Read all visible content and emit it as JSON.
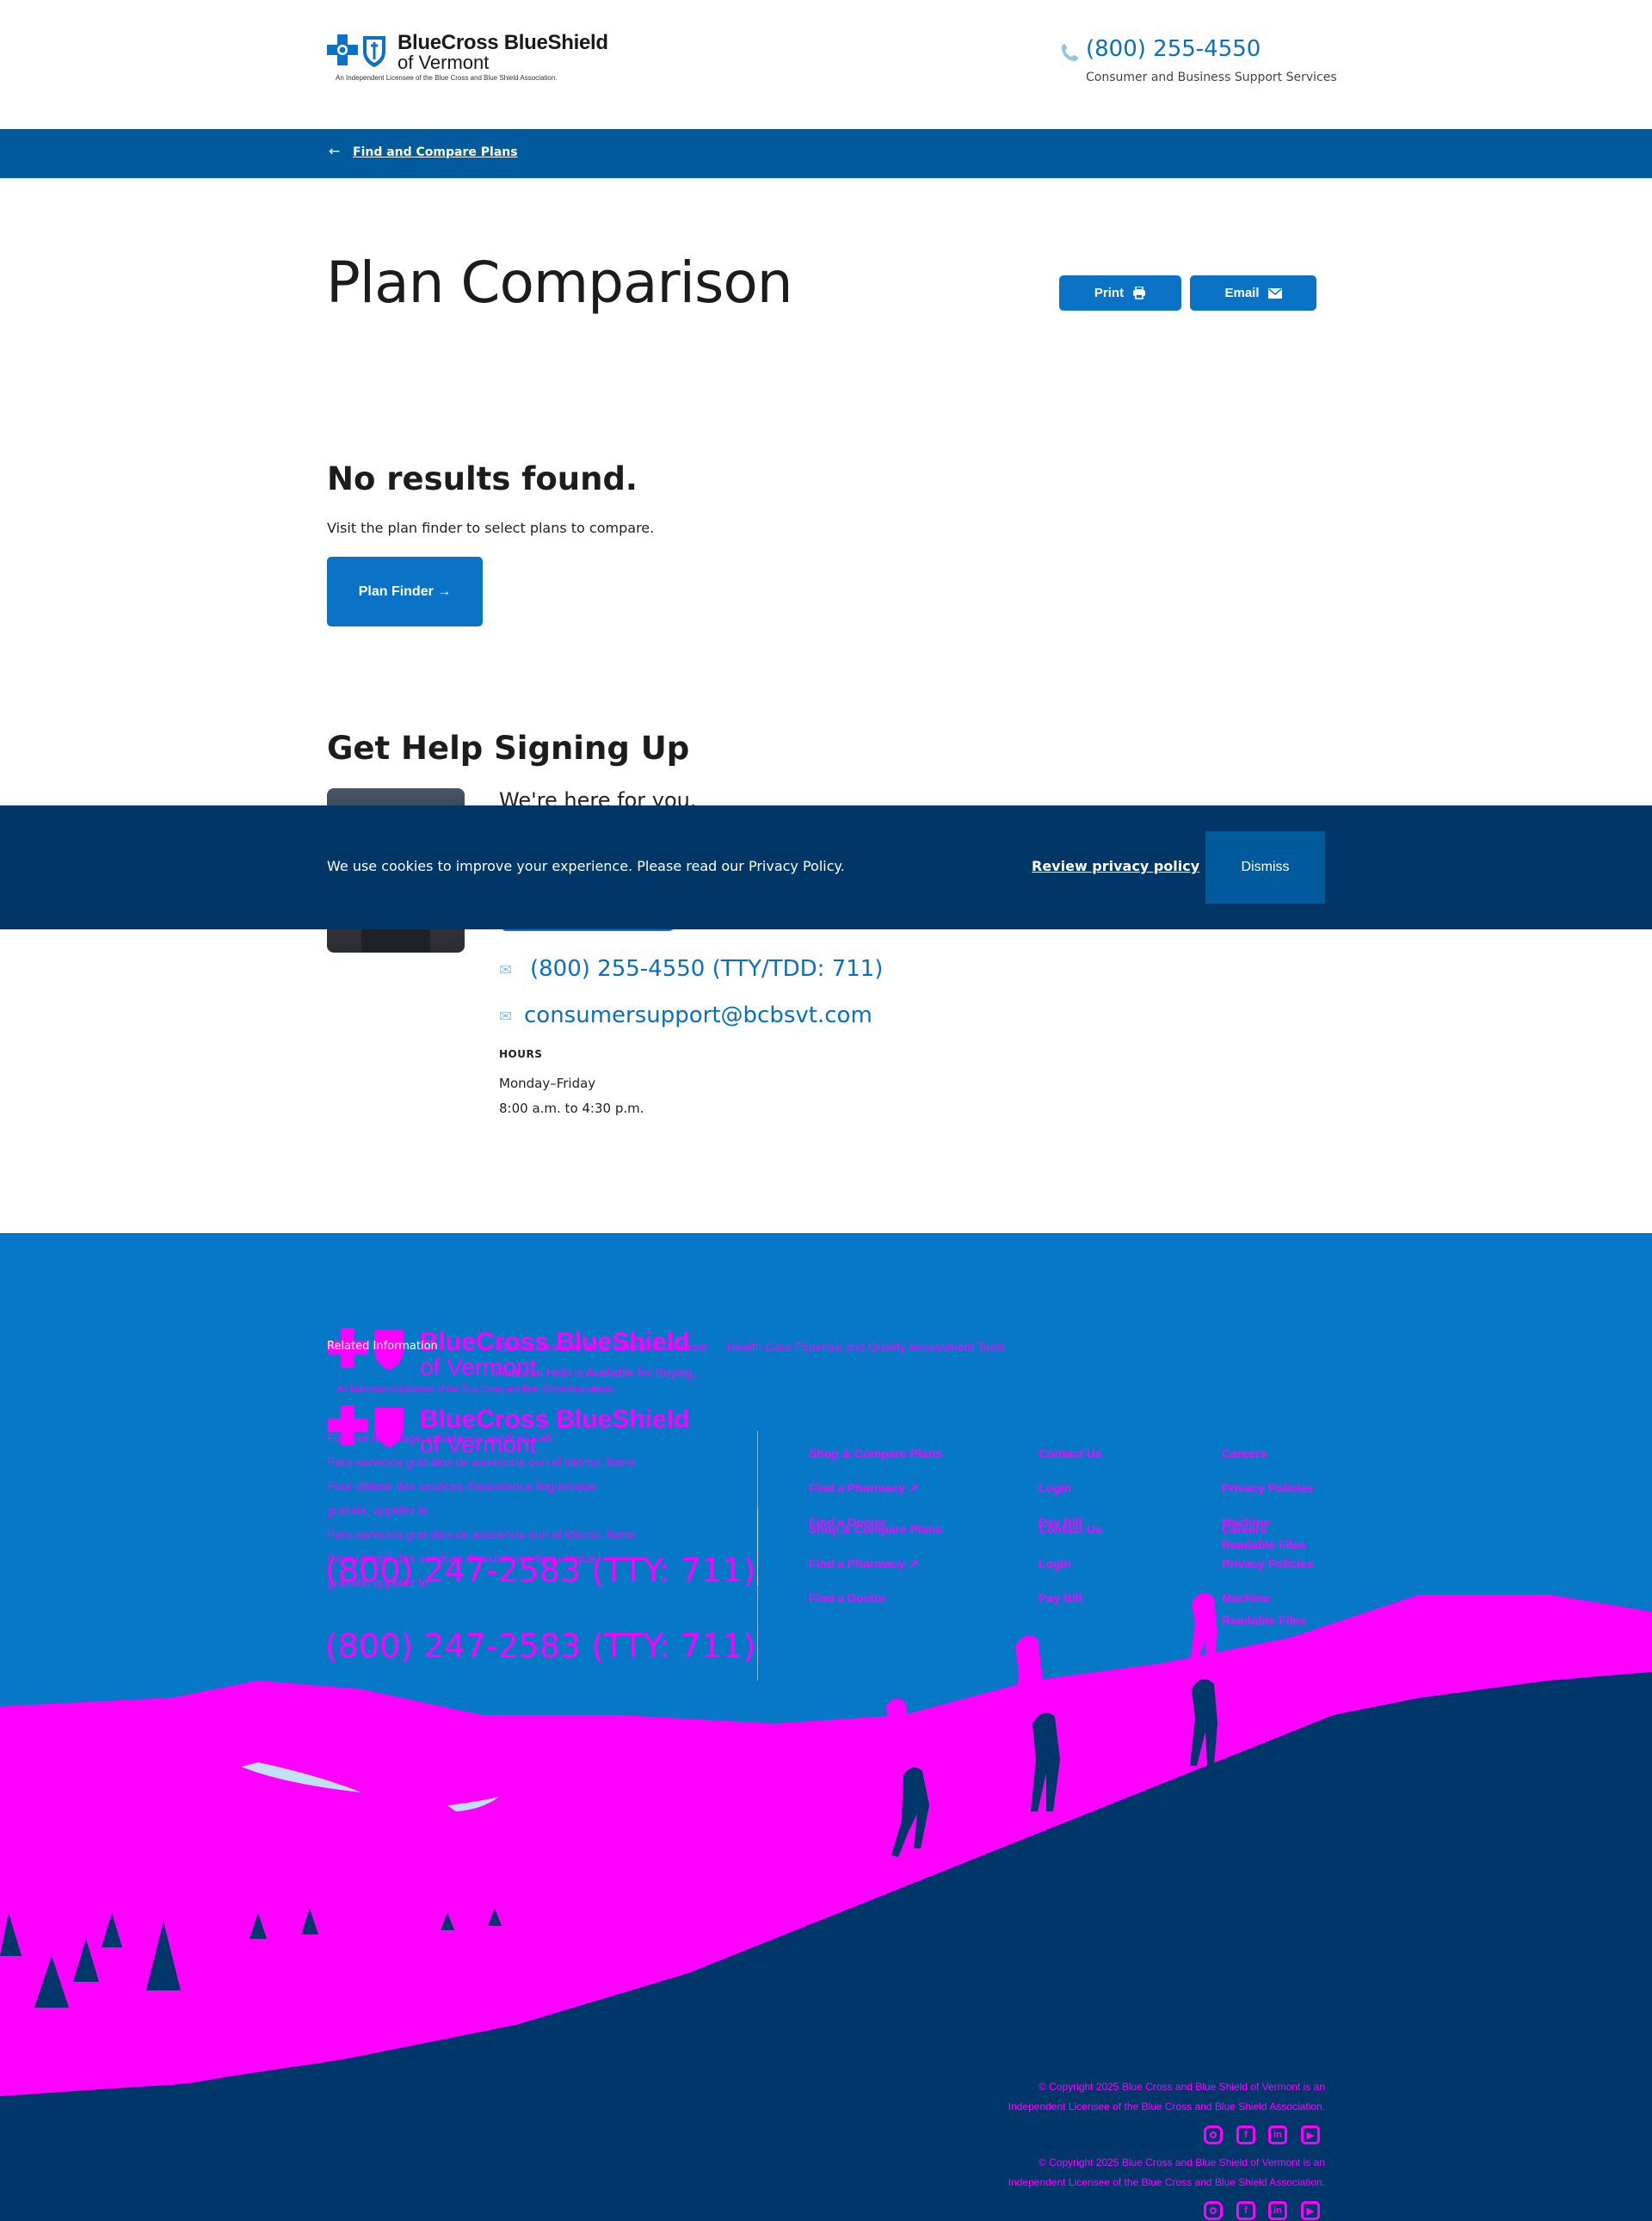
{
  "header": {
    "logo_name": "BlueCross BlueShield",
    "logo_sub": "of Vermont",
    "logo_tagline": "An Independent Licensee of the Blue Cross and Blue Shield Association.",
    "phone": "(800) 255-4550",
    "phone_sub": "Consumer and Business Support Services"
  },
  "nav": {
    "back_label": "Find and Compare Plans"
  },
  "main": {
    "title": "Plan Comparison",
    "print_label": "Print",
    "email_label": "Email",
    "no_results_title": "No results found.",
    "no_results_text": "Visit the plan finder to select plans to compare.",
    "plan_finder_label": "Plan Finder →"
  },
  "help": {
    "title": "Get Help Signing Up",
    "subtitle": "We're here for you.",
    "phone": "(800) 255-4550 (TTY/TDD: 711)",
    "email": "consumersupport@bcbsvt.com",
    "hours_label": "HOURS",
    "hours_days": "Monday–Friday",
    "hours_time": "8:00 a.m. to 4:30 p.m."
  },
  "cookie": {
    "text": "We use cookies to improve your experience. Please read our Privacy Policy.",
    "review_label": "Review privacy policy",
    "dismiss_label": "Dismiss"
  },
  "footer": {
    "logo_name": "BlueCross BlueShield",
    "logo_sub": "of Vermont",
    "logo_tagline": "An Independent Licensee of the Blue Cross and Blue Shield Association.",
    "related_label": "Related Information",
    "related_links": [
      "Blue Cross and Blue Shield of Vermont",
      "Health Care Expense and Quality Assessment Tools",
      "Financial Help is Available for Buying..."
    ],
    "lang_lines": [
      "For free language assistance services call:",
      "Para servicios gratuitos de asistencia con el idioma, llame",
      "Pour obtenir des services d'assistance linguistique",
      "gratuits, appelez le"
    ],
    "lang_phone": "(800) 247-2583 (TTY: 711)",
    "col1": [
      "Shop & Compare Plans",
      "Find a Pharmacy",
      "Find a Doctor"
    ],
    "col2": [
      "Contact Us",
      "Login",
      "Pay Bill"
    ],
    "col3": [
      "Careers",
      "Privacy Policies",
      "Machine",
      "Readable Files"
    ],
    "copyright_line1": "© Copyright 2025 Blue Cross and Blue Shield of Vermont is an",
    "copyright_line2": "Independent Licensee of the Blue Cross and Blue Shield Association.",
    "social": [
      "instagram-icon",
      "facebook-icon",
      "linkedin-icon",
      "youtube-icon"
    ]
  },
  "colors": {
    "brand_blue": "#0a73c6",
    "nav_blue": "#005a9c",
    "cookie_navy": "#003767",
    "footer_blue": "#0777c8",
    "footer_text_magenta": "#ff00ff"
  }
}
